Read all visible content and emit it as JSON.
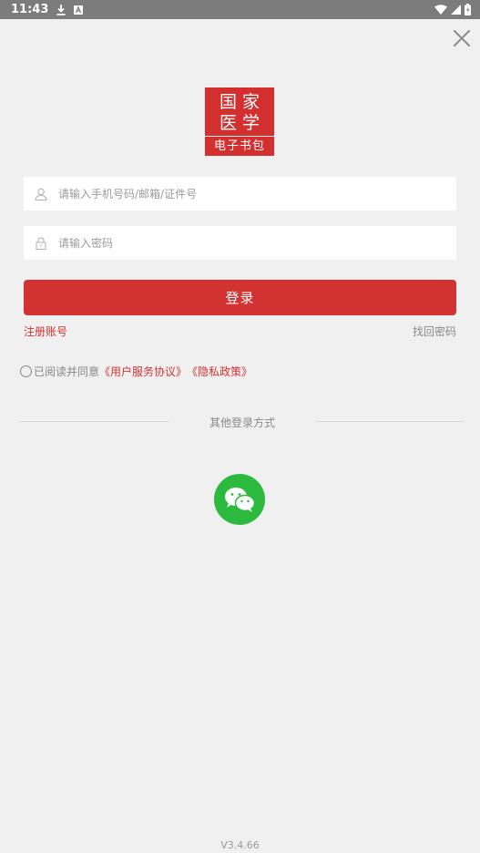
{
  "status_bar": {
    "time": "11:43",
    "icons": [
      "download-icon",
      "font-a-icon",
      "wifi-icon",
      "signal-icon",
      "battery-icon"
    ]
  },
  "close_icon": "close-icon",
  "logo": {
    "row1": [
      "国",
      "家"
    ],
    "row2": [
      "医",
      "学"
    ],
    "subtitle": "电子书包",
    "color": "#d42f2f"
  },
  "form": {
    "username_placeholder": "请输入手机号码/邮箱/证件号",
    "username_icon": "user-icon",
    "password_placeholder": "请输入密码",
    "password_icon": "lock-icon",
    "login_label": "登录",
    "register_label": "注册账号",
    "forgot_label": "找回密码"
  },
  "agreement": {
    "prefix": "已阅读并同意",
    "service_link": "《用户服务协议》",
    "privacy_link": "《隐私政策》",
    "checked": false
  },
  "other_login": {
    "label": "其他登录方式",
    "wechat_icon": "wechat-icon"
  },
  "version": "V3.4.66",
  "colors": {
    "accent": "#d23232",
    "background": "#f0f0f0",
    "wechat": "#2bba3e"
  }
}
